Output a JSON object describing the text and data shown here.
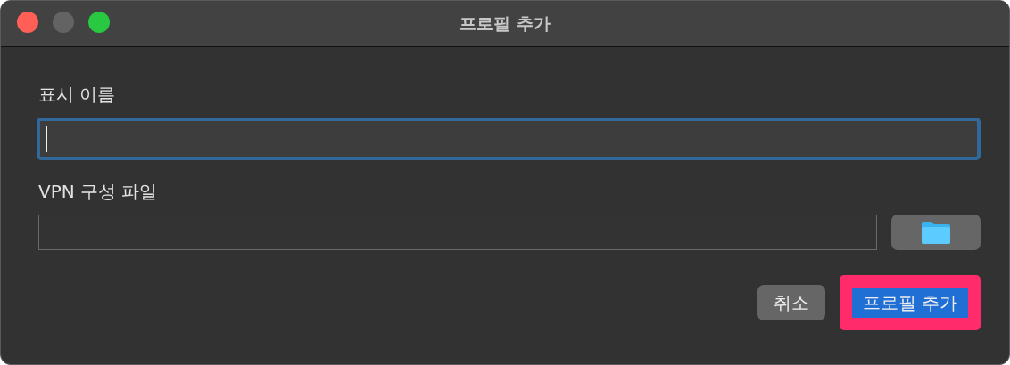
{
  "window": {
    "title": "프로필 추가"
  },
  "fields": [
    {
      "label": "표시 이름",
      "focused": true,
      "kind": "text"
    },
    {
      "label": "VPN 구성 파일",
      "focused": false,
      "kind": "file"
    }
  ],
  "buttons": [
    {
      "label": "취소",
      "kind": "secondary",
      "highlighted": false
    },
    {
      "label": "프로필 추가",
      "kind": "primary",
      "highlighted": true
    }
  ]
}
